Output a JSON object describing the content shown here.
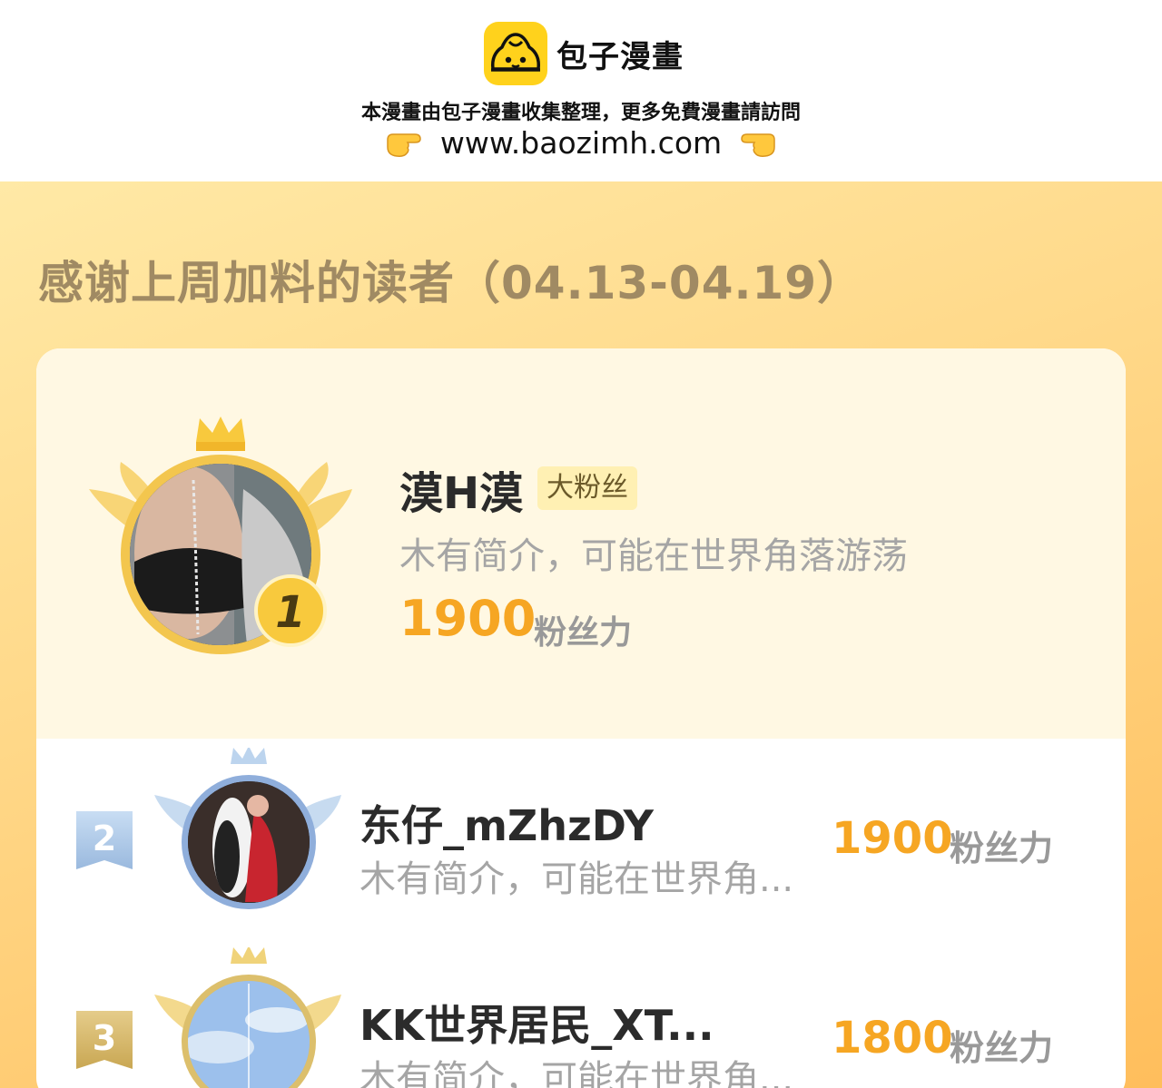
{
  "header": {
    "brand_name": "包子漫畫",
    "notice": "本漫畫由包子漫畫收集整理，更多免費漫畫請訪問",
    "url": "www.baozimh.com",
    "accent_color": "#ffd21c"
  },
  "panel": {
    "title": "感谢上周加料的读者（04.13-04.19）"
  },
  "leaderboard": [
    {
      "rank": "1",
      "name": "漠H漠",
      "badge": "大粉丝",
      "bio": "木有简介，可能在世界角落游荡",
      "score": "1900",
      "unit": "粉丝力"
    },
    {
      "rank": "2",
      "name": "东仔_mZhzDY",
      "bio": "木有简介，可能在世界角...",
      "score": "1900",
      "unit": "粉丝力"
    },
    {
      "rank": "3",
      "name": "KK世界居民_XT...",
      "bio": "木有简介，可能在世界角...",
      "score": "1800",
      "unit": "粉丝力"
    }
  ],
  "colors": {
    "gold": "#f6a623",
    "silver": "#a9c6e6",
    "bronze": "#d4b46a"
  }
}
